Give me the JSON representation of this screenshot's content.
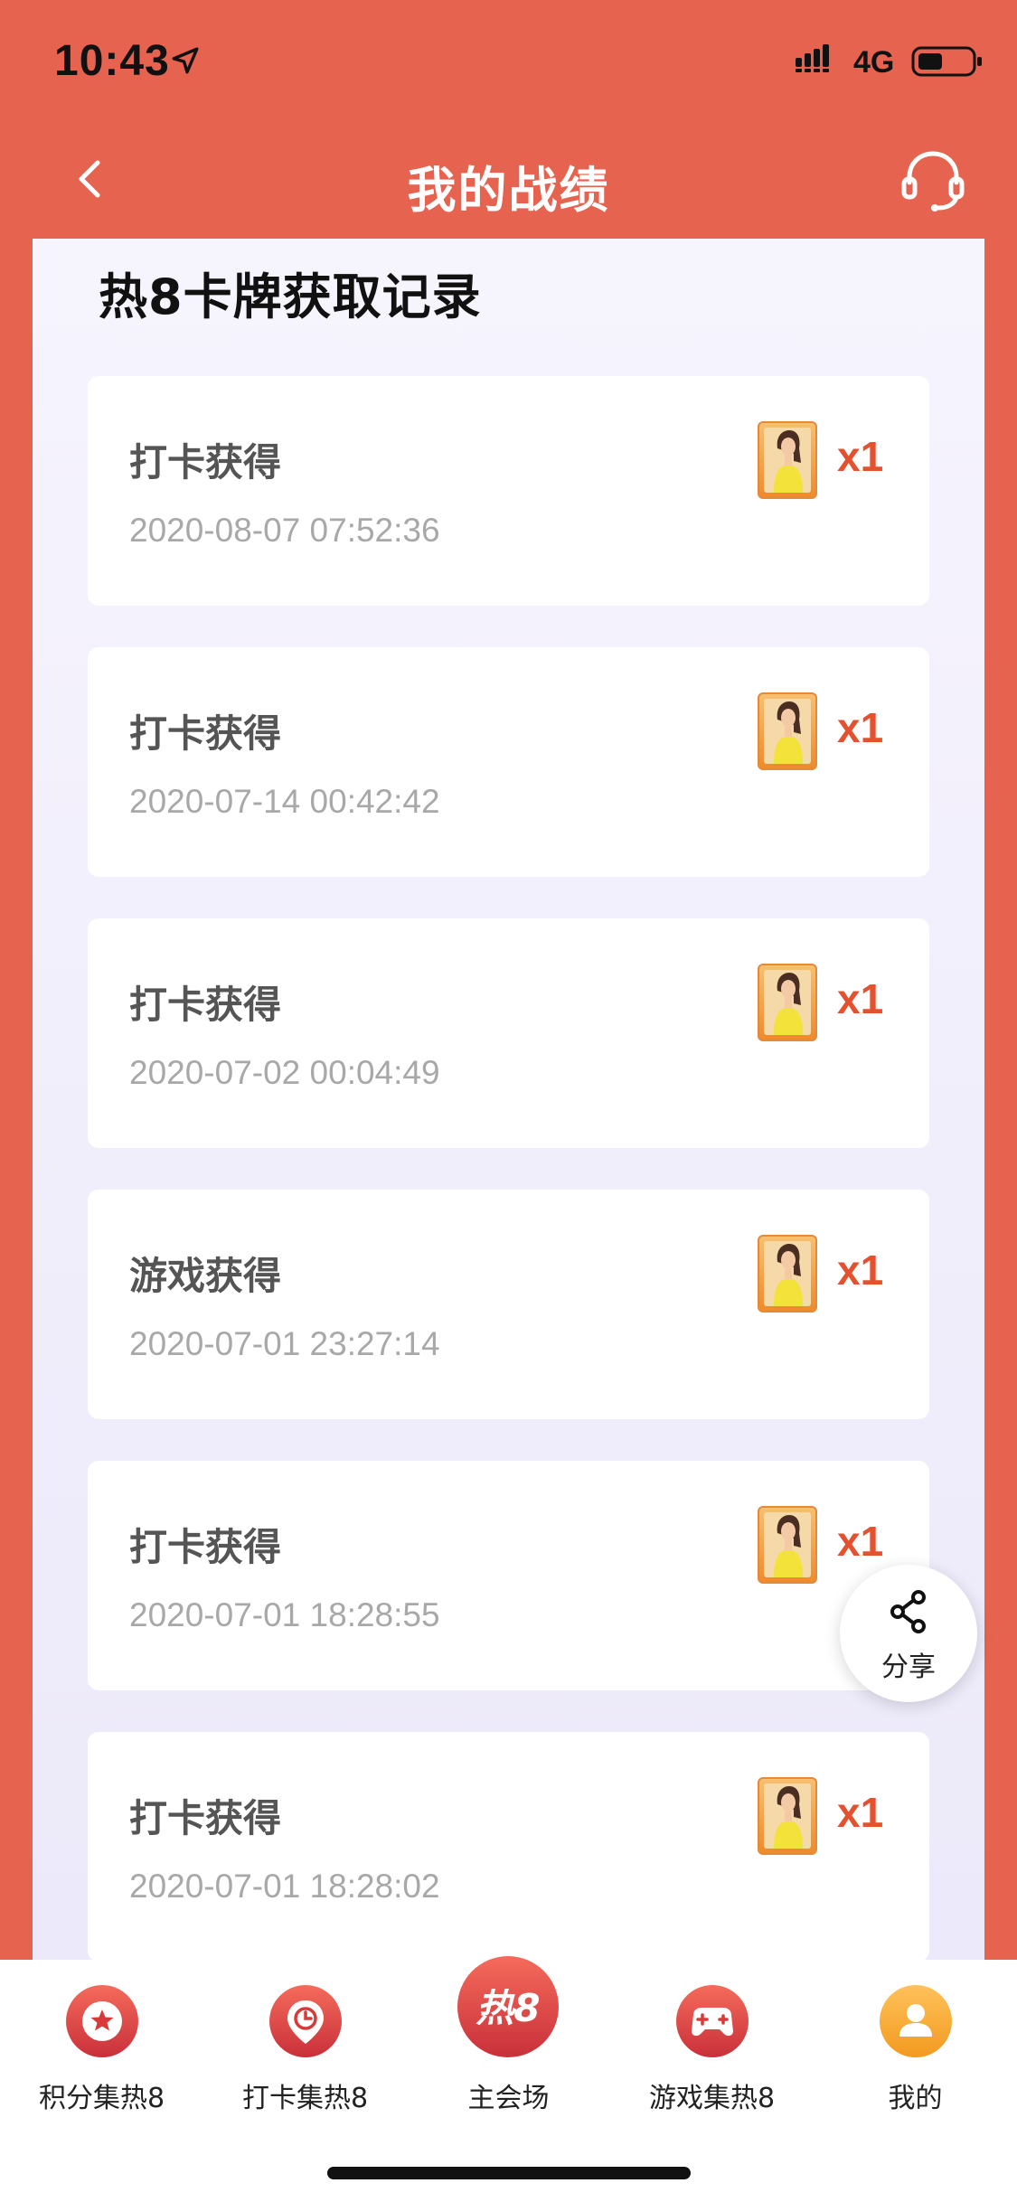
{
  "status_bar": {
    "time": "10:43",
    "network": "4G"
  },
  "nav": {
    "title": "我的战绩"
  },
  "section": {
    "title": "热8卡牌获取记录"
  },
  "records": [
    {
      "source": "打卡获得",
      "time": "2020-08-07 07:52:36",
      "qty": "x1"
    },
    {
      "source": "打卡获得",
      "time": "2020-07-14 00:42:42",
      "qty": "x1"
    },
    {
      "source": "打卡获得",
      "time": "2020-07-02 00:04:49",
      "qty": "x1"
    },
    {
      "source": "游戏获得",
      "time": "2020-07-01 23:27:14",
      "qty": "x1"
    },
    {
      "source": "打卡获得",
      "time": "2020-07-01 18:28:55",
      "qty": "x1"
    },
    {
      "source": "打卡获得",
      "time": "2020-07-01 18:28:02",
      "qty": "x1"
    }
  ],
  "share": {
    "label": "分享"
  },
  "tabs": [
    {
      "label": "积分集热8",
      "icon": "star-badge-icon"
    },
    {
      "label": "打卡集热8",
      "icon": "clock-pin-icon"
    },
    {
      "label": "主会场",
      "icon": "hot8-logo-icon",
      "badge_text": "热8"
    },
    {
      "label": "游戏集热8",
      "icon": "gamepad-icon"
    },
    {
      "label": "我的",
      "icon": "user-icon"
    }
  ],
  "colors": {
    "brand": "#E66350",
    "accent_qty": "#E4512F",
    "tab_icon_red": "#E04A3A",
    "tab_icon_orange": "#F5A623"
  }
}
